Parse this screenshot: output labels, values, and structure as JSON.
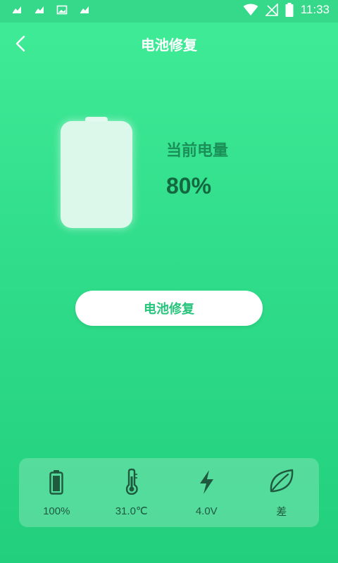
{
  "status_bar": {
    "time": "11:33",
    "left_icons": [
      "notification-icon",
      "notification-icon",
      "image-icon",
      "notification-icon"
    ],
    "right_icons": [
      "wifi-icon",
      "no-signal-icon",
      "battery-icon"
    ]
  },
  "app_bar": {
    "back_icon": "chevron-left-icon",
    "title": "电池修复"
  },
  "battery_card": {
    "label": "当前电量",
    "value": "80%",
    "level": 0.8
  },
  "repair_button": {
    "label": "电池修复"
  },
  "stats": [
    {
      "icon": "battery-icon",
      "value": "100%"
    },
    {
      "icon": "thermometer-icon",
      "value": "31.0℃"
    },
    {
      "icon": "lightning-icon",
      "value": "4.0V"
    },
    {
      "icon": "leaf-icon",
      "value": "差"
    }
  ],
  "colors": {
    "background_top": "#41ec97",
    "background_bottom": "#22cf7d",
    "button_text": "#27c57c",
    "label_text": "#1a8f58",
    "value_text": "#13683f",
    "stat_text": "#1f5a3f"
  }
}
